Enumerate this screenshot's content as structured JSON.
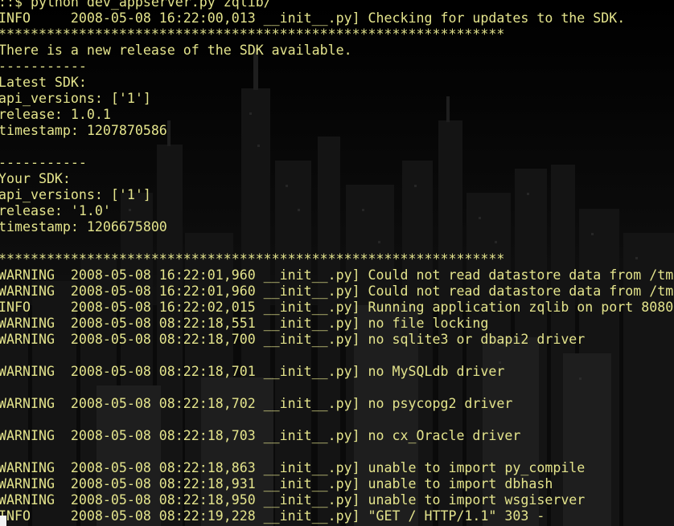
{
  "terminal": {
    "background_icon": "city-skyline-icon",
    "text_color": "#e4e48c",
    "lines": [
      "::$ python dev_appserver.py zqlib/",
      "INFO     2008-05-08 16:22:00,013 __init__.py] Checking for updates to the SDK.",
      "***************************************************************",
      "There is a new release of the SDK available.",
      "-----------",
      "Latest SDK:",
      "api_versions: ['1']",
      "release: 1.0.1",
      "timestamp: 1207870586",
      "",
      "-----------",
      "Your SDK:",
      "api_versions: ['1']",
      "release: '1.0'",
      "timestamp: 1206675800",
      "",
      "***************************************************************",
      "WARNING  2008-05-08 16:22:01,960 __init__.py] Could not read datastore data from /tm",
      "WARNING  2008-05-08 16:22:01,960 __init__.py] Could not read datastore data from /tm",
      "INFO     2008-05-08 16:22:02,015 __init__.py] Running application zqlib on port 8080",
      "WARNING  2008-05-08 08:22:18,551 __init__.py] no file locking",
      "WARNING  2008-05-08 08:22:18,700 __init__.py] no sqlite3 or dbapi2 driver",
      "",
      "WARNING  2008-05-08 08:22:18,701 __init__.py] no MySQLdb driver",
      "",
      "WARNING  2008-05-08 08:22:18,702 __init__.py] no psycopg2 driver",
      "",
      "WARNING  2008-05-08 08:22:18,703 __init__.py] no cx_Oracle driver",
      "",
      "WARNING  2008-05-08 08:22:18,863 __init__.py] unable to import py_compile",
      "WARNING  2008-05-08 08:22:18,931 __init__.py] unable to import dbhash",
      "WARNING  2008-05-08 08:22:18,950 __init__.py] unable to import wsgiserver",
      "INFO     2008-05-08 08:22:19,228 __init__.py] \"GET / HTTP/1.1\" 303 -"
    ]
  }
}
